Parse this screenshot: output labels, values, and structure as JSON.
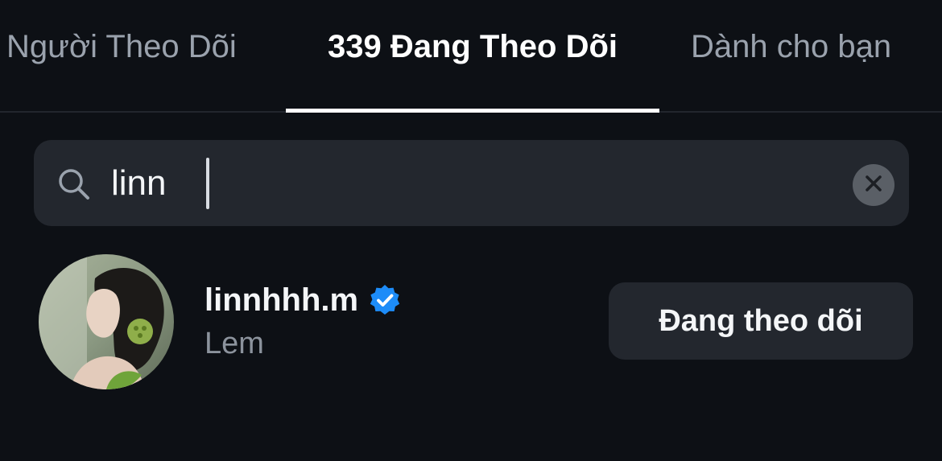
{
  "tabs": [
    {
      "label": "Người Theo Dõi",
      "active": false
    },
    {
      "label": "339 Đang Theo Dõi",
      "active": true
    },
    {
      "label": "Dành cho bạn",
      "active": false
    }
  ],
  "search": {
    "value": "linn",
    "icon": "search-icon",
    "clear_icon": "close-icon"
  },
  "results": [
    {
      "username": "linnhhh.m",
      "verified": true,
      "full_name": "Lem",
      "button_label": "Đang theo dõi"
    }
  ],
  "colors": {
    "background": "#0d1015",
    "surface": "#23272e",
    "text_primary": "#f4f6f8",
    "text_secondary": "#8c939d",
    "verified_blue": "#1d8cf8"
  }
}
